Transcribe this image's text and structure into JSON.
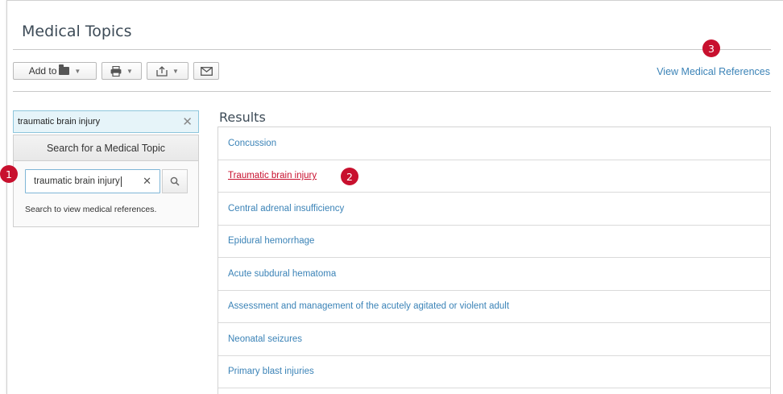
{
  "page": {
    "title": "Medical Topics"
  },
  "toolbar": {
    "add_to_label": "Add to",
    "view_refs_label": "View Medical References"
  },
  "search": {
    "top_value": "traumatic brain injury",
    "panel_header": "Search for a Medical Topic",
    "inner_value": "traumatic brain injury",
    "hint": "Search to view medical references."
  },
  "results": {
    "title": "Results",
    "items": [
      "Concussion",
      "Traumatic brain injury",
      "Central adrenal insufficiency",
      "Epidural hemorrhage",
      "Acute subdural hematoma",
      "Assessment and management of the acutely agitated or violent adult",
      "Neonatal seizures",
      "Primary blast injuries"
    ]
  },
  "callouts": {
    "one": "1",
    "two": "2",
    "three": "3"
  },
  "colors": {
    "accent": "#c8102e",
    "link": "#3b83b7",
    "search_bg": "#e6f4f9"
  }
}
